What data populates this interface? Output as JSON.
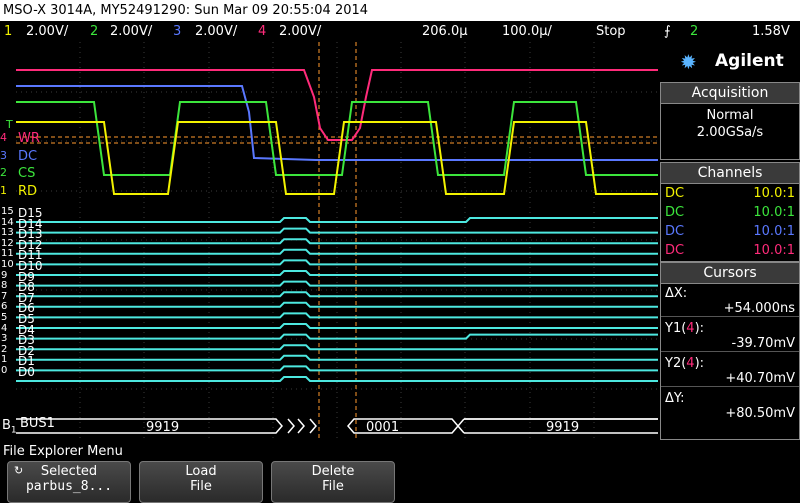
{
  "title": "MSO-X 3014A, MY52491290: Sun Mar 09 20:55:04 2014",
  "status": {
    "ch1_num": "1",
    "ch1_scale": "2.00V/",
    "ch2_num": "2",
    "ch2_scale": "2.00V/",
    "ch3_num": "3",
    "ch3_scale": "2.00V/",
    "ch4_num": "4",
    "ch4_scale": "2.00V/",
    "time_offset": "206.0µ",
    "time_scale": "100.0µ/",
    "run_state": "Stop",
    "trig_channel": "2",
    "trig_level": "1.58V"
  },
  "brand": "Agilent",
  "acquisition": {
    "header": "Acquisition",
    "mode": "Normal",
    "rate": "2.00GSa/s"
  },
  "channels": {
    "header": "Channels",
    "rows": [
      {
        "coupling": "DC",
        "probe": "10.0:1",
        "color": "#f2f200"
      },
      {
        "coupling": "DC",
        "probe": "10.0:1",
        "color": "#3ce63c"
      },
      {
        "coupling": "DC",
        "probe": "10.0:1",
        "color": "#5a78ff"
      },
      {
        "coupling": "DC",
        "probe": "10.0:1",
        "color": "#ff2b7a"
      }
    ]
  },
  "cursors": {
    "header": "Cursors",
    "dx_label": "ΔX:",
    "dx_value": "+54.000ns",
    "y1_label_a": "Y1(",
    "y1_label_b": "4",
    "y1_label_c": "):",
    "y1_value": "-39.70mV",
    "y2_label_a": "Y2(",
    "y2_label_b": "4",
    "y2_label_c": "):",
    "y2_value": "+40.70mV",
    "dy_label": "ΔY:",
    "dy_value": "+80.50mV"
  },
  "analog_labels": {
    "wr": "WR",
    "dc": "DC",
    "cs": "CS",
    "rd": "RD",
    "m4": "4",
    "m3": "3",
    "m2": "2",
    "m1": "1",
    "mt": "T"
  },
  "digital_labels": [
    "D15",
    "D14",
    "D13",
    "D12",
    "D11",
    "D10",
    "D9",
    "D8",
    "D7",
    "D6",
    "D5",
    "D4",
    "D3",
    "D2",
    "D1",
    "D0"
  ],
  "digital_markers": [
    "15",
    "14",
    "13",
    "12",
    "11",
    "10",
    "9",
    "8",
    "7",
    "6",
    "5",
    "4",
    "3",
    "2",
    "1",
    "0"
  ],
  "bus": {
    "marker": "B",
    "marker_sub": "1",
    "label": "BUS1",
    "values": [
      "9919",
      "0001",
      "9919"
    ]
  },
  "softkeys": {
    "menu_title": "File Explorer Menu",
    "selected_top": "Selected",
    "selected_bottom": "parbus_8...",
    "load_top": "Load",
    "load_bottom": "File",
    "delete_top": "Delete",
    "delete_bottom": "File"
  },
  "colors": {
    "ch1": "#f2f200",
    "ch2": "#3ce63c",
    "ch3": "#5a78ff",
    "ch4": "#ff2b7a",
    "digital": "#4de8e0",
    "bus": "#ffffff",
    "cursor": "#ff9a2e"
  }
}
